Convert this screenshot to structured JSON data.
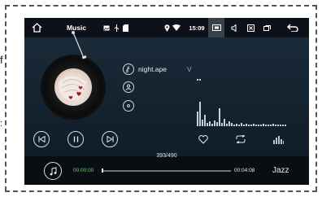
{
  "statusbar": {
    "app_title": "Music",
    "clock": "15:09",
    "icons": [
      "home-icon",
      "image-icon",
      "usb-icon",
      "sd-card-icon",
      "location-icon",
      "wifi-icon",
      "screenshot-icon",
      "volume-icon",
      "close-box-icon",
      "window-icon",
      "back-icon"
    ]
  },
  "track": {
    "name": "night.ape",
    "name_suffix": "V",
    "counter": "393/490",
    "current_time": "00:00:00",
    "total_time": "00:04:08",
    "progress_fraction": 0.0
  },
  "equalizer_mode": "Jazz",
  "stray": {
    "left_char": "f",
    "left_char2": ":"
  },
  "colors": {
    "background": "#152431",
    "statusbar": "#0c1218",
    "elapsed": "#6fd16f"
  }
}
